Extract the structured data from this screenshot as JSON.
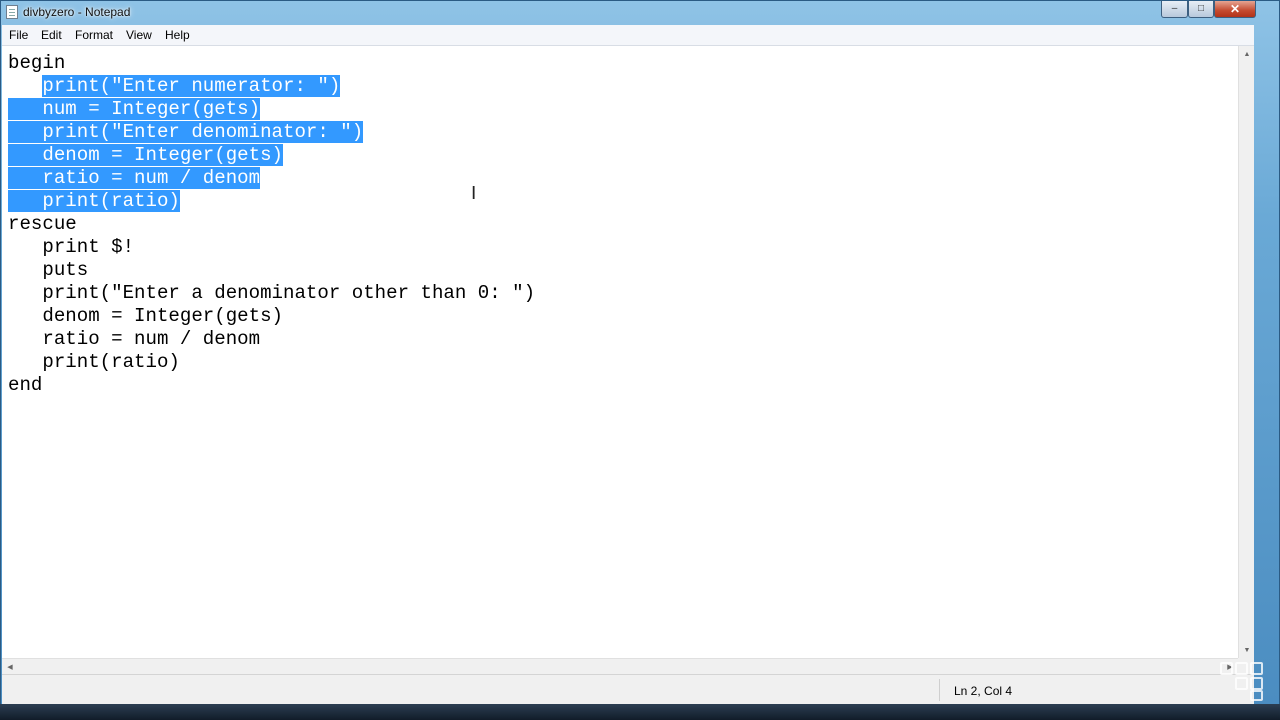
{
  "window": {
    "title": "divbyzero - Notepad"
  },
  "controls": {
    "minimize": "–",
    "maximize": "□",
    "close": "✕"
  },
  "menu": [
    "File",
    "Edit",
    "Format",
    "View",
    "Help"
  ],
  "editor": {
    "lines": [
      {
        "pre": "begin",
        "sel": "",
        "post": ""
      },
      {
        "pre": "   ",
        "sel": "print(\"Enter numerator: \")",
        "post": ""
      },
      {
        "pre": "",
        "sel": "   num = Integer(gets)",
        "post": ""
      },
      {
        "pre": "",
        "sel": "   print(\"Enter denominator: \")",
        "post": ""
      },
      {
        "pre": "",
        "sel": "   denom = Integer(gets)",
        "post": ""
      },
      {
        "pre": "",
        "sel": "   ratio = num / denom",
        "post": ""
      },
      {
        "pre": "",
        "sel": "   print(ratio)",
        "post": ""
      },
      {
        "pre": "rescue",
        "sel": "",
        "post": ""
      },
      {
        "pre": "   print $!",
        "sel": "",
        "post": ""
      },
      {
        "pre": "   puts",
        "sel": "",
        "post": ""
      },
      {
        "pre": "   print(\"Enter a denominator other than 0: \")",
        "sel": "",
        "post": ""
      },
      {
        "pre": "   denom = Integer(gets)",
        "sel": "",
        "post": ""
      },
      {
        "pre": "   ratio = num / denom",
        "sel": "",
        "post": ""
      },
      {
        "pre": "   print(ratio)",
        "sel": "",
        "post": ""
      },
      {
        "pre": "end",
        "sel": "",
        "post": ""
      }
    ]
  },
  "status": {
    "position": "Ln 2, Col 4"
  },
  "icons": {
    "app": "notepad-icon",
    "cursor": "text-cursor-icon",
    "watermark": "watermark-logo-icon"
  },
  "colors": {
    "selection": "#3399ff",
    "selection_text": "#ffffff"
  }
}
